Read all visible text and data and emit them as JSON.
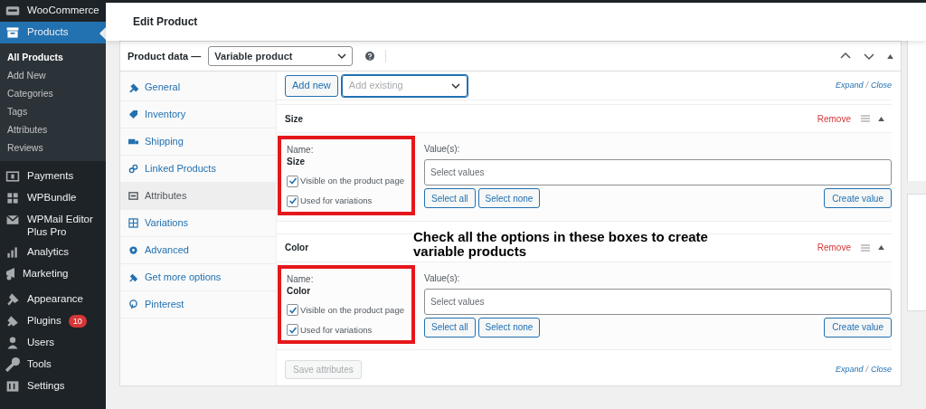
{
  "sidebar": {
    "groups": [
      [
        {
          "label": "WooCommerce",
          "selected": false
        },
        {
          "label": "Products",
          "selected": true,
          "children": [
            {
              "label": "All Products",
              "selected": true
            },
            {
              "label": "Add New",
              "selected": false
            },
            {
              "label": "Categories",
              "selected": false
            },
            {
              "label": "Tags",
              "selected": false
            },
            {
              "label": "Attributes",
              "selected": false
            },
            {
              "label": "Reviews",
              "selected": false
            }
          ]
        }
      ],
      [
        {
          "label": "Payments",
          "selected": false
        },
        {
          "label": "WPBundle",
          "selected": false
        },
        {
          "label": "WPMail Editor Plus Pro",
          "selected": false
        },
        {
          "label": "Analytics",
          "selected": false
        },
        {
          "label": "Marketing",
          "selected": false
        }
      ],
      [
        {
          "label": "Appearance",
          "selected": false
        },
        {
          "label": "Plugins",
          "selected": false,
          "badge": "10"
        },
        {
          "label": "Users",
          "selected": false
        },
        {
          "label": "Tools",
          "selected": false
        },
        {
          "label": "Settings",
          "selected": false
        }
      ]
    ]
  },
  "page_title": "Edit Product",
  "product_data": {
    "label": "Product data —",
    "type_select": "Variable product",
    "tabs": [
      {
        "label": "General",
        "selected": false
      },
      {
        "label": "Inventory",
        "selected": false
      },
      {
        "label": "Shipping",
        "selected": false
      },
      {
        "label": "Linked Products",
        "selected": false
      },
      {
        "label": "Attributes",
        "selected": true
      },
      {
        "label": "Variations",
        "selected": false
      },
      {
        "label": "Advanced",
        "selected": false
      },
      {
        "label": "Get more options",
        "selected": false
      },
      {
        "label": "Pinterest",
        "selected": false
      }
    ],
    "add_new_button": "Add new",
    "add_existing_placeholder": "Add existing",
    "expand_close": [
      "Expand",
      "/",
      "Close"
    ],
    "attributes": [
      {
        "title": "Size",
        "remove": "Remove",
        "name_label": "Name:",
        "name": "Size",
        "options": [
          {
            "label": "Visible on the product page",
            "checked": true
          },
          {
            "label": "Used for variations",
            "checked": true
          }
        ],
        "values_label": "Value(s):",
        "values_placeholder": "Select values",
        "buttons": [
          "Select all",
          "Select none"
        ],
        "create_button": "Create value"
      },
      {
        "title": "Color",
        "remove": "Remove",
        "name_label": "Name:",
        "name": "Color",
        "options": [
          {
            "label": "Visible on the product page",
            "checked": true
          },
          {
            "label": "Used for variations",
            "checked": true
          }
        ],
        "values_label": "Value(s):",
        "values_placeholder": "Select values",
        "buttons": [
          "Select all",
          "Select none"
        ],
        "create_button": "Create value"
      }
    ],
    "save_button": "Save attributes",
    "footer_expand_close": [
      "Expand",
      "/",
      "Close"
    ]
  },
  "annotation": "Check all the options in these boxes to create variable products"
}
